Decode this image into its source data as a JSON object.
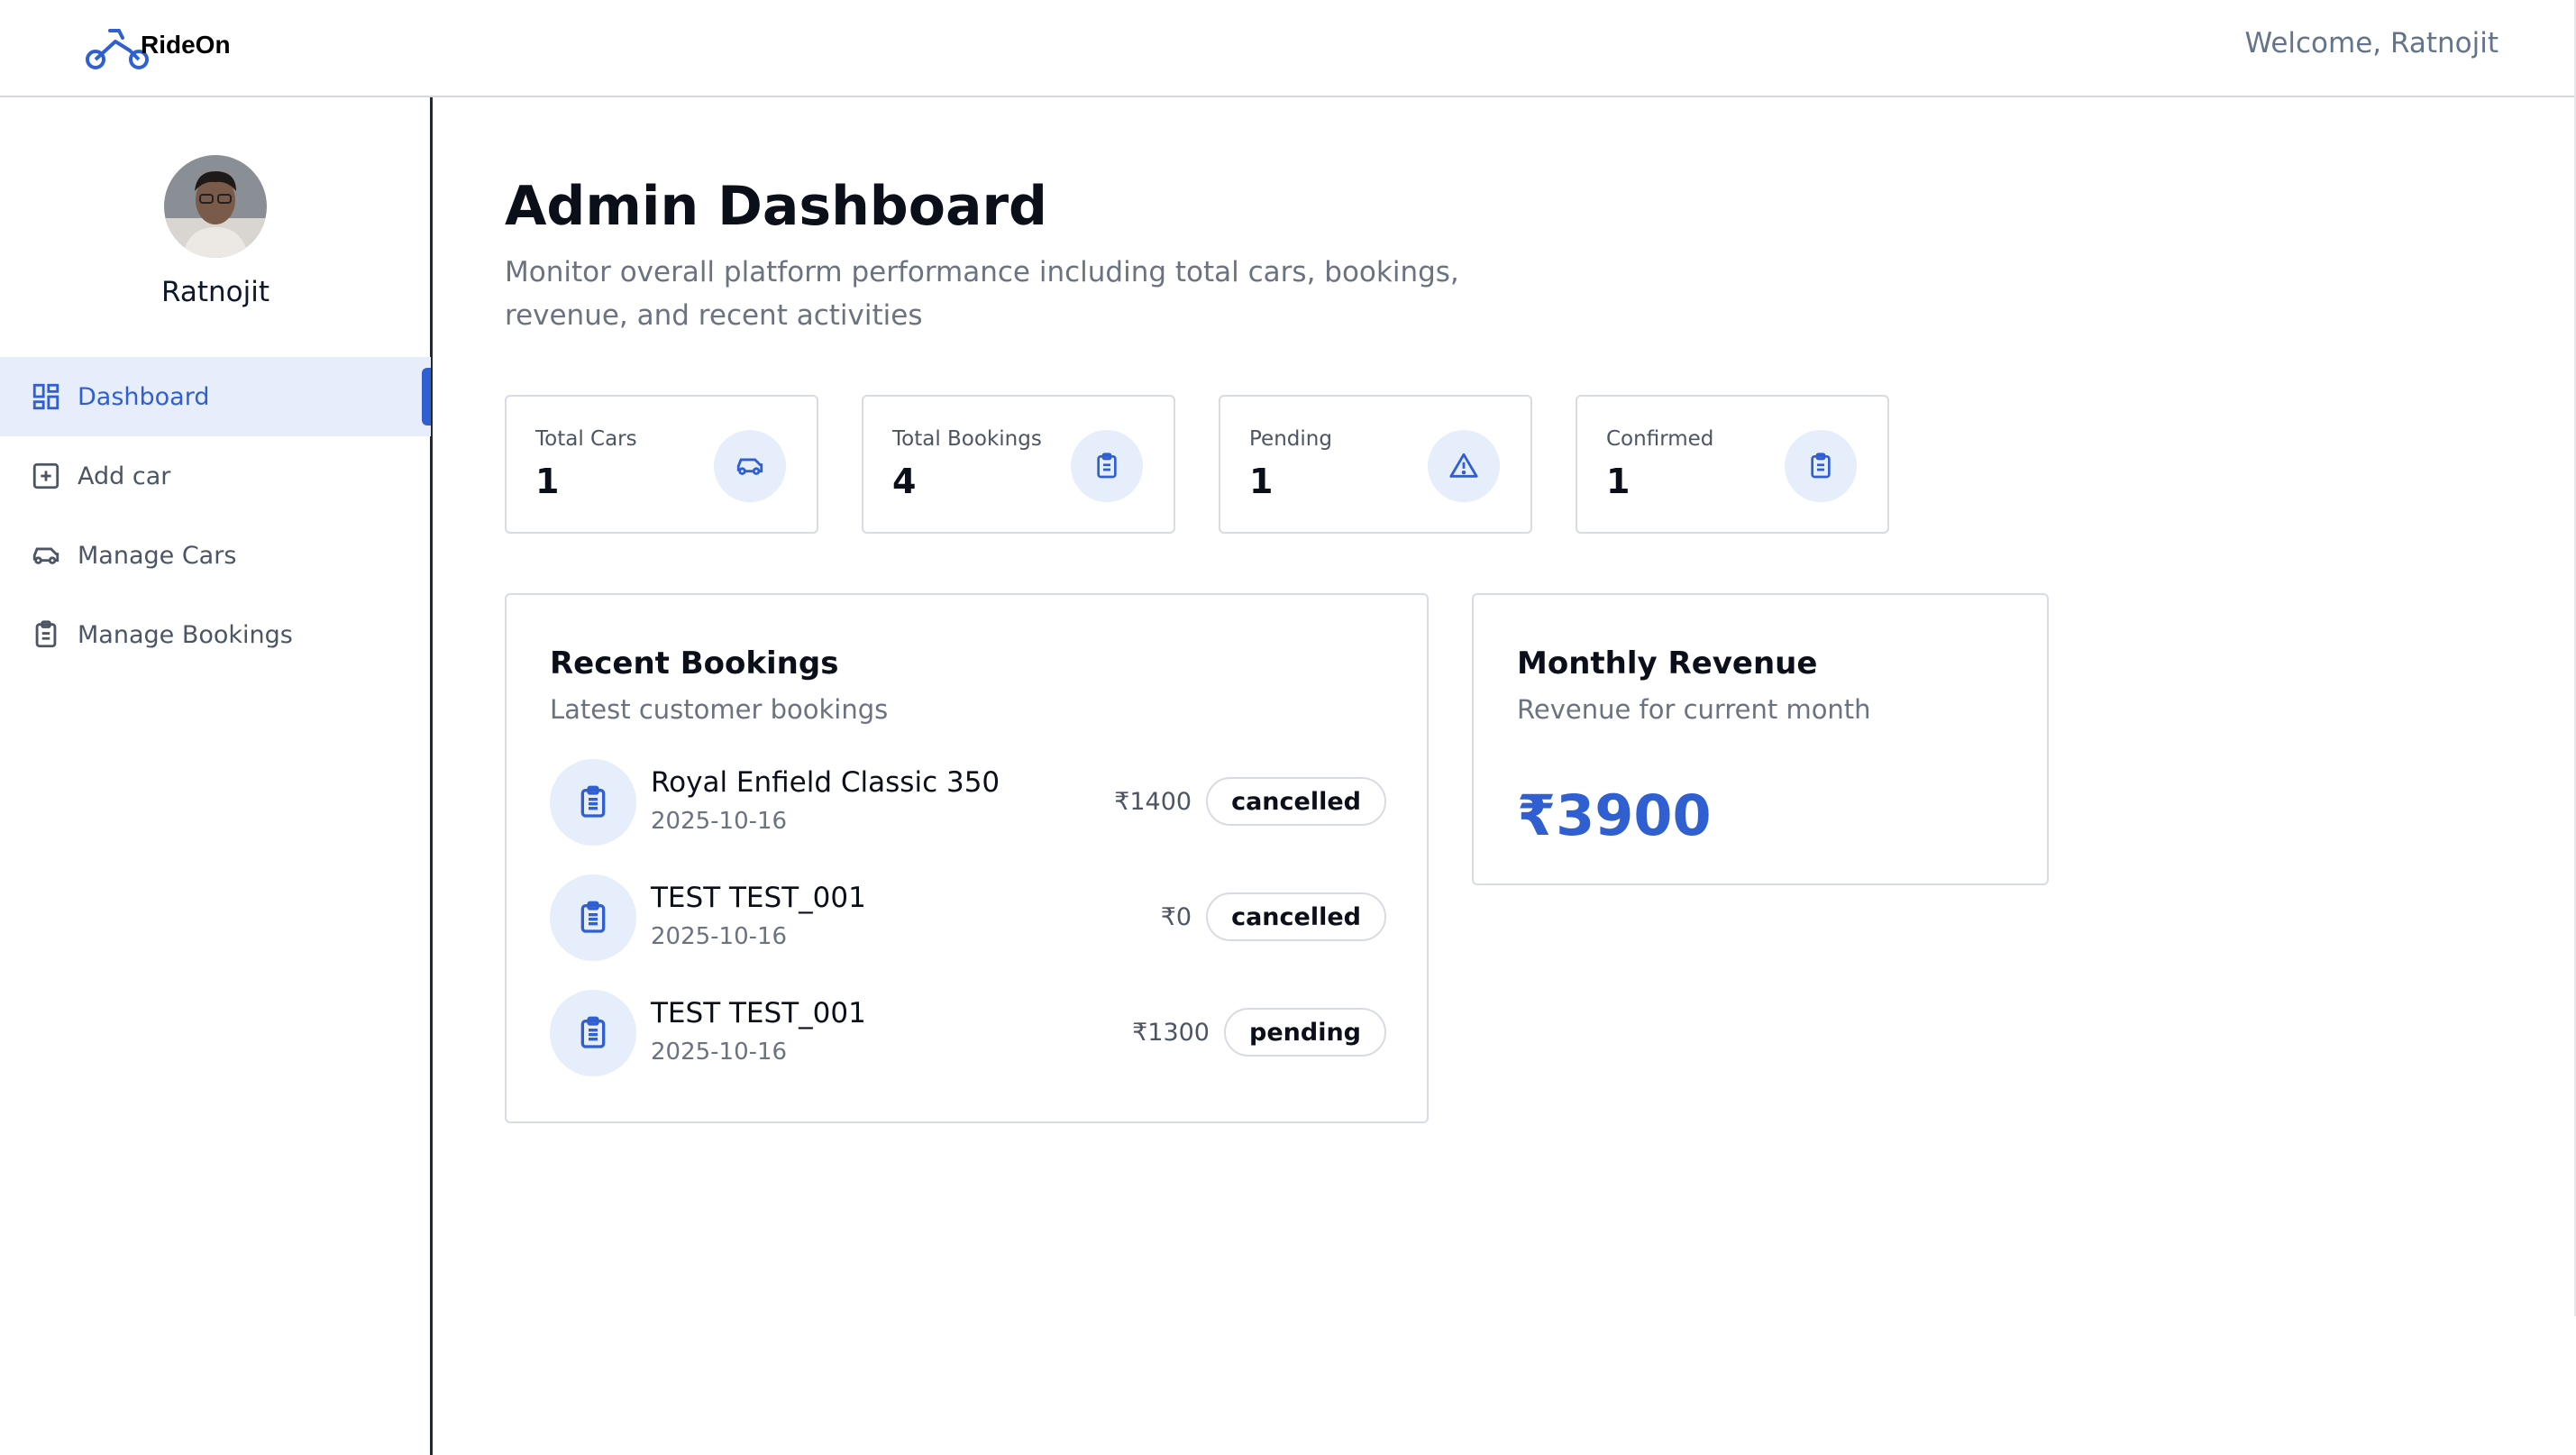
{
  "app": {
    "brand": "RideOn",
    "welcome": "Welcome, Ratnojit",
    "accent_color": "#2f5fd0"
  },
  "sidebar": {
    "profile_name": "Ratnojit",
    "items": [
      {
        "label": "Dashboard",
        "icon": "dashboard-grid-icon",
        "active": true
      },
      {
        "label": "Add car",
        "icon": "add-square-icon",
        "active": false
      },
      {
        "label": "Manage Cars",
        "icon": "car-icon",
        "active": false
      },
      {
        "label": "Manage Bookings",
        "icon": "clipboard-icon",
        "active": false
      }
    ]
  },
  "main": {
    "title": "Admin Dashboard",
    "subtitle": "Monitor overall platform performance including total cars, bookings, revenue, and recent activities",
    "stats": [
      {
        "label": "Total Cars",
        "value": "1",
        "icon": "car-icon"
      },
      {
        "label": "Total Bookings",
        "value": "4",
        "icon": "clipboard-icon"
      },
      {
        "label": "Pending",
        "value": "1",
        "icon": "warning-icon"
      },
      {
        "label": "Confirmed",
        "value": "1",
        "icon": "clipboard-icon"
      }
    ],
    "recent": {
      "title": "Recent Bookings",
      "subtitle": "Latest customer bookings",
      "bookings": [
        {
          "name": "Royal Enfield Classic 350",
          "date": "2025-10-16",
          "price": "₹1400",
          "status": "cancelled"
        },
        {
          "name": "TEST TEST_001",
          "date": "2025-10-16",
          "price": "₹0",
          "status": "cancelled"
        },
        {
          "name": "TEST TEST_001",
          "date": "2025-10-16",
          "price": "₹1300",
          "status": "pending"
        }
      ]
    },
    "revenue": {
      "title": "Monthly Revenue",
      "subtitle": "Revenue for current month",
      "value": "₹3900"
    }
  }
}
